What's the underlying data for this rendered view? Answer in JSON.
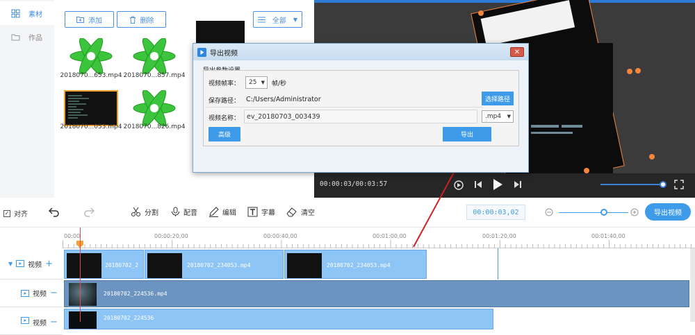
{
  "sidebar": {
    "items": [
      {
        "label": "素材",
        "icon": "grid-icon"
      },
      {
        "label": "作品",
        "icon": "folder-icon"
      }
    ]
  },
  "library": {
    "add_label": "添加",
    "delete_label": "删除",
    "filter_label": "全部",
    "files": [
      {
        "name": "2018070...653.mp4",
        "kind": "flower"
      },
      {
        "name": "2018070...857.mp4",
        "kind": "flower"
      },
      {
        "name": "2018070...053.mp4",
        "kind": "screen"
      },
      {
        "name": "2018070...826.mp4",
        "kind": "flower"
      }
    ]
  },
  "player": {
    "time": "00:00:03/00:03:57",
    "volume": 0.9
  },
  "toolbar": {
    "align_label": "对齐",
    "cut_label": "分割",
    "dub_label": "配音",
    "edit_label": "编辑",
    "subtitle_label": "字幕",
    "clear_label": "清空",
    "timecode": "00:00:03,02",
    "export_label": "导出视频"
  },
  "ruler": {
    "ticks": [
      "00:00",
      "00:00:20,00",
      "00:00:40,00",
      "00:01:00,00",
      "00:01:20,00",
      "00:01:40,00"
    ]
  },
  "tracks": [
    {
      "label": "视频",
      "sign": "+"
    },
    {
      "label": "视频",
      "sign": "−"
    },
    {
      "label": "视频",
      "sign": "−"
    }
  ],
  "clips": {
    "track1": [
      "20180702_2",
      "20180702_234053.mp4",
      "20180702_234053.mp4"
    ],
    "track2": "20180702_224536.mp4",
    "track3": "20180702_224536"
  },
  "dialog": {
    "title": "导出视频",
    "group_title": "导出参数设置",
    "fps_label": "视频帧率：",
    "fps_value": "25",
    "fps_unit": "帧/秒",
    "path_label": "保存路径：",
    "path_value": "C:/Users/Administrator",
    "choose_path": "选择路径",
    "name_label": "视频名称：",
    "name_value": "ev_20180703_003439",
    "format": ".mp4",
    "advanced": "高级",
    "export": "导出",
    "close": "✕"
  },
  "colors": {
    "accent": "#3d9be9",
    "arrow": "#d01f1f",
    "clip": "#8ec5f7",
    "clip_dark": "#6b95c0",
    "handle": "#f4863b"
  }
}
